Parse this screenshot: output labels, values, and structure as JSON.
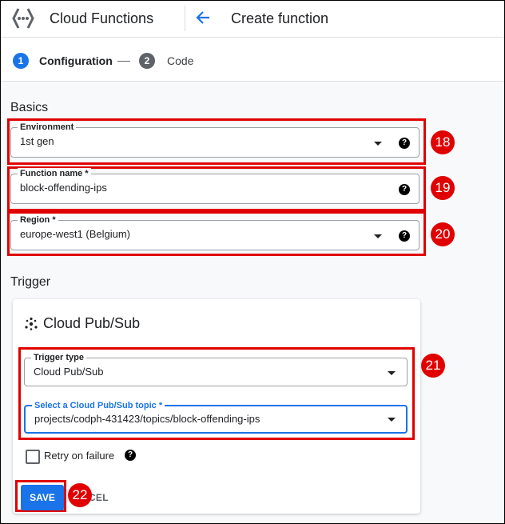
{
  "header": {
    "app_name": "Cloud Functions",
    "page_title": "Create function"
  },
  "stepper": {
    "steps": [
      {
        "number": "1",
        "label": "Configuration",
        "active": true
      },
      {
        "number": "2",
        "label": "Code",
        "active": false
      }
    ]
  },
  "basics": {
    "title": "Basics",
    "environment": {
      "label": "Environment",
      "value": "1st gen"
    },
    "function_name": {
      "label": "Function name *",
      "value": "block-offending-ips"
    },
    "region": {
      "label": "Region *",
      "value": "europe-west1 (Belgium)"
    }
  },
  "trigger": {
    "title": "Trigger",
    "card_title": "Cloud Pub/Sub",
    "trigger_type": {
      "label": "Trigger type",
      "value": "Cloud Pub/Sub"
    },
    "topic": {
      "label": "Select a Cloud Pub/Sub topic *",
      "value": "projects/codph-431423/topics/block-offending-ips"
    },
    "retry_label": "Retry on failure",
    "save_label": "SAVE",
    "cancel_label": "NCEL"
  },
  "annotations": [
    "18",
    "19",
    "20",
    "21",
    "22"
  ],
  "colors": {
    "accent": "#1a73e8",
    "annotation": "#e00000"
  },
  "icons": [
    "cloud-functions-logo-icon",
    "back-arrow-icon",
    "help-icon",
    "dropdown-caret-icon",
    "pubsub-icon"
  ]
}
